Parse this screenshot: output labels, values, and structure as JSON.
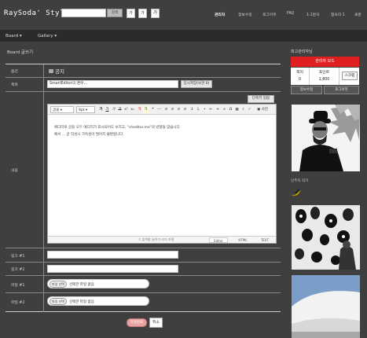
{
  "header": {
    "logo": "RaySoda' Style",
    "search": {
      "placeholder": "",
      "button": "검색"
    },
    "font_buttons": [
      "가",
      "가",
      "가"
    ],
    "nav": [
      "관리자",
      "정보수정",
      "로그아웃",
      "FAQ",
      "1:1문의",
      "접속자 1",
      "쇄문"
    ]
  },
  "subnav": {
    "board": "Board",
    "gallery": "Gallery"
  },
  "form": {
    "title": "Board 글쓰기",
    "options": {
      "label": "옵션",
      "notice": "공지"
    },
    "subject": {
      "label": "제목",
      "value": "SmartEditor의 경우...",
      "temp_save": "임시저장(보관 0)"
    },
    "shortcut_button": "단축키 일람",
    "content": {
      "label": "내용",
      "lines": [
        "에디터로 글을 모두 에디터가 표시되어도 보지고, \"cheditor.me\"의 방향을 맞습니다.",
        "예서 ... 글 작성시 가독성이 떨어지 불편합니다."
      ],
      "toolbar": {
        "font": "글꼴",
        "size": "9pt",
        "extra": "사진"
      },
      "resize": "입력창 늘이기·크기 조절",
      "modes": [
        "Editor",
        "HTML",
        "TEXT"
      ]
    },
    "link1": {
      "label": "링크 #1",
      "value": ""
    },
    "link2": {
      "label": "링크 #2",
      "value": ""
    },
    "file1": {
      "label": "파일 #1",
      "button": "파일 선택",
      "status": "선택한 파일 없음"
    },
    "file2": {
      "label": "파일 #2",
      "button": "파일 선택",
      "status": "선택한 파일 없음"
    },
    "submit": "작성완료",
    "cancel": "취소"
  },
  "sidebar": {
    "title": "최고관리자님",
    "admin_button": "관리자 모드",
    "stats": [
      {
        "label": "쪽지",
        "value": "0"
      },
      {
        "label": "포인트",
        "value": "1,800"
      }
    ],
    "scrap": "스크랩",
    "edit_profile": "정보수정",
    "logout": "로그아웃",
    "section": "신주옥 의가"
  }
}
